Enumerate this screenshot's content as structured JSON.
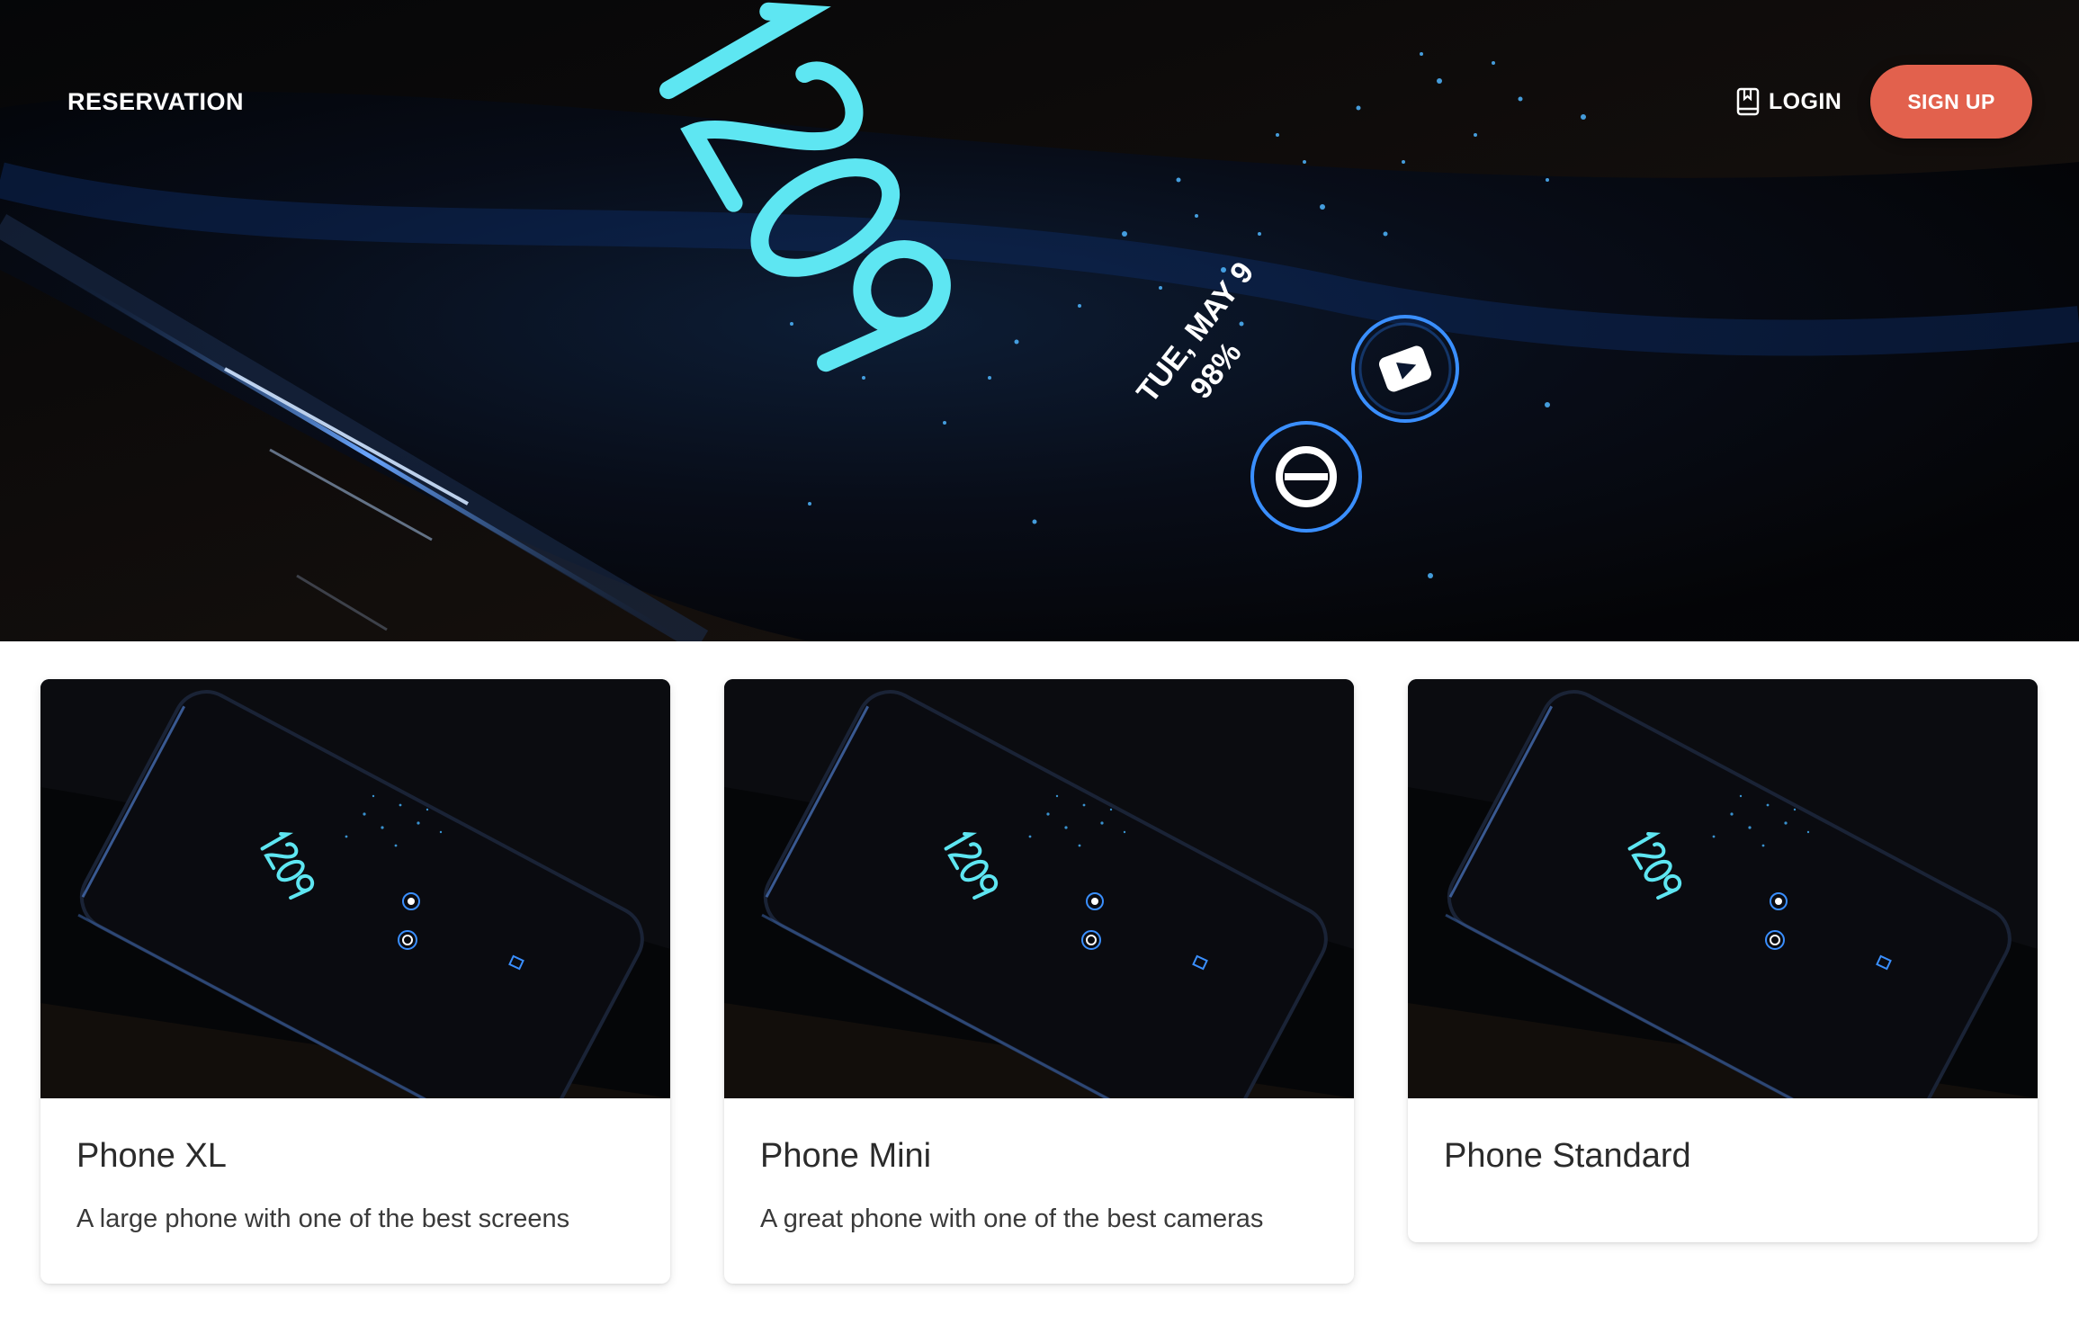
{
  "hero": {
    "clock_top": "12",
    "clock_bottom": "09",
    "date": "TUE, MAY 9",
    "battery": "98%"
  },
  "navbar": {
    "brand": "RESERVATION",
    "login_label": "LOGIN",
    "signup_label": "SIGN UP",
    "accent_color": "#e2614d"
  },
  "cards": [
    {
      "title": "Phone XL",
      "description": "A large phone with one of the best screens"
    },
    {
      "title": "Phone Mini",
      "description": "A great phone with one of the best cameras"
    },
    {
      "title": "Phone Standard",
      "description": ""
    }
  ],
  "icons": {
    "login": "book-icon"
  }
}
